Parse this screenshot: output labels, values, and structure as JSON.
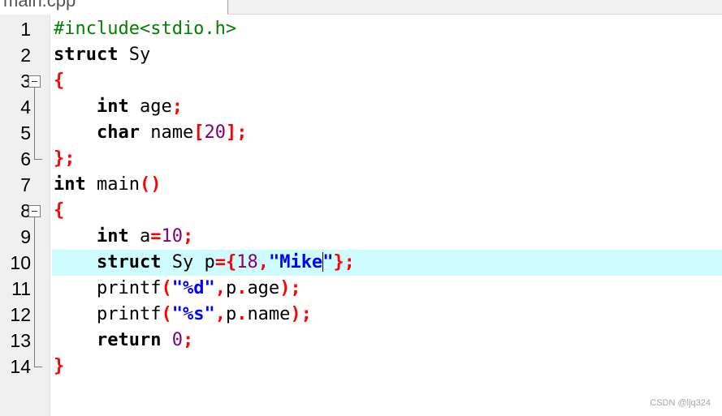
{
  "tab": {
    "label": "main.cpp"
  },
  "watermark": "CSDN @ljq324",
  "colors": {
    "keyword": "#000000",
    "preprocessor": "#008000",
    "operator": "#ff0000",
    "number": "#800080",
    "string": "#0000ff",
    "current_line": "#cffcff"
  },
  "lines": [
    {
      "number": "1",
      "tokens": [
        {
          "t": "pp",
          "v": "#include<stdio.h>"
        }
      ]
    },
    {
      "number": "2",
      "tokens": [
        {
          "t": "kw",
          "v": "struct"
        },
        {
          "t": "tx",
          "v": " Sy"
        }
      ]
    },
    {
      "number": "3",
      "fold": "open",
      "tokens": [
        {
          "t": "op",
          "v": "{"
        }
      ]
    },
    {
      "number": "4",
      "tokens": [
        {
          "t": "tx",
          "v": "    "
        },
        {
          "t": "kw",
          "v": "int"
        },
        {
          "t": "tx",
          "v": " age"
        },
        {
          "t": "op",
          "v": ";"
        }
      ]
    },
    {
      "number": "5",
      "tokens": [
        {
          "t": "tx",
          "v": "    "
        },
        {
          "t": "kw",
          "v": "char"
        },
        {
          "t": "tx",
          "v": " name"
        },
        {
          "t": "op",
          "v": "["
        },
        {
          "t": "num",
          "v": "20"
        },
        {
          "t": "op",
          "v": "];"
        }
      ]
    },
    {
      "number": "6",
      "fold": "end",
      "tokens": [
        {
          "t": "op",
          "v": "};"
        }
      ]
    },
    {
      "number": "7",
      "tokens": [
        {
          "t": "kw",
          "v": "int"
        },
        {
          "t": "tx",
          "v": " main"
        },
        {
          "t": "op",
          "v": "()"
        }
      ]
    },
    {
      "number": "8",
      "fold": "open",
      "tokens": [
        {
          "t": "op",
          "v": "{"
        }
      ]
    },
    {
      "number": "9",
      "tokens": [
        {
          "t": "tx",
          "v": "    "
        },
        {
          "t": "kw",
          "v": "int"
        },
        {
          "t": "tx",
          "v": " a"
        },
        {
          "t": "op",
          "v": "="
        },
        {
          "t": "num",
          "v": "10"
        },
        {
          "t": "op",
          "v": ";"
        }
      ]
    },
    {
      "number": "10",
      "current": true,
      "tokens": [
        {
          "t": "tx",
          "v": "    "
        },
        {
          "t": "kw",
          "v": "struct"
        },
        {
          "t": "tx",
          "v": " Sy p"
        },
        {
          "t": "op",
          "v": "={"
        },
        {
          "t": "num",
          "v": "18"
        },
        {
          "t": "op",
          "v": ","
        },
        {
          "t": "str",
          "v": "\"Mike"
        },
        {
          "t": "caret",
          "v": ""
        },
        {
          "t": "str",
          "v": "\""
        },
        {
          "t": "op",
          "v": "};"
        }
      ]
    },
    {
      "number": "11",
      "tokens": [
        {
          "t": "tx",
          "v": "    printf"
        },
        {
          "t": "op",
          "v": "("
        },
        {
          "t": "str",
          "v": "\"%d\""
        },
        {
          "t": "op",
          "v": ","
        },
        {
          "t": "tx",
          "v": "p"
        },
        {
          "t": "op",
          "v": "."
        },
        {
          "t": "tx",
          "v": "age"
        },
        {
          "t": "op",
          "v": ");"
        }
      ]
    },
    {
      "number": "12",
      "tokens": [
        {
          "t": "tx",
          "v": "    printf"
        },
        {
          "t": "op",
          "v": "("
        },
        {
          "t": "str",
          "v": "\"%s\""
        },
        {
          "t": "op",
          "v": ","
        },
        {
          "t": "tx",
          "v": "p"
        },
        {
          "t": "op",
          "v": "."
        },
        {
          "t": "tx",
          "v": "name"
        },
        {
          "t": "op",
          "v": ");"
        }
      ]
    },
    {
      "number": "13",
      "tokens": [
        {
          "t": "tx",
          "v": "    "
        },
        {
          "t": "kw",
          "v": "return"
        },
        {
          "t": "tx",
          "v": " "
        },
        {
          "t": "num",
          "v": "0"
        },
        {
          "t": "op",
          "v": ";"
        }
      ]
    },
    {
      "number": "14",
      "fold": "end",
      "tokens": [
        {
          "t": "op",
          "v": "}"
        }
      ]
    }
  ]
}
